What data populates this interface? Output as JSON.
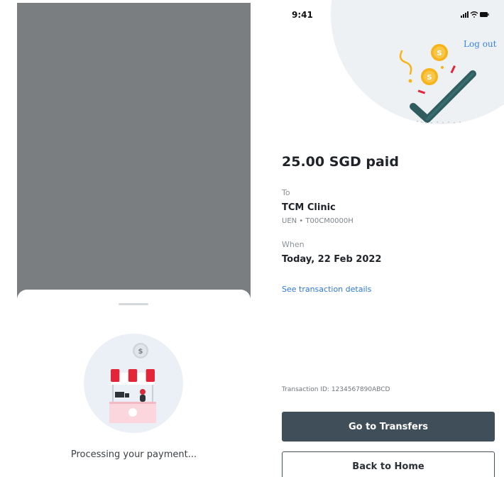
{
  "left_screen": {
    "processing_text": "Processing your payment...",
    "coin_symbol": "$"
  },
  "right_screen": {
    "status_time": "9:41",
    "logout_label": "Log out",
    "coin_symbol": "S",
    "amount_title": "25.00 SGD paid",
    "to_label": "To",
    "merchant_name": "TCM Clinic",
    "uen_text": "UEN • T00CM0000H",
    "when_label": "When",
    "date_text": "Today, 22 Feb 2022",
    "details_link": "See transaction details",
    "transaction_id": "Transaction ID: 1234567890ABCD",
    "primary_button": "Go to Transfers",
    "secondary_button": "Back to Home"
  },
  "colors": {
    "overlay": "#7b7e80",
    "primary_button": "#3f4e58",
    "link": "#2f78d9",
    "check": "#2f5c5e",
    "coin": "#f6b31a",
    "awning_red": "#e3253a"
  },
  "icons": [
    "signal-icon",
    "wifi-icon",
    "battery-icon",
    "coin-icon",
    "check-icon",
    "market-stall-icon"
  ]
}
